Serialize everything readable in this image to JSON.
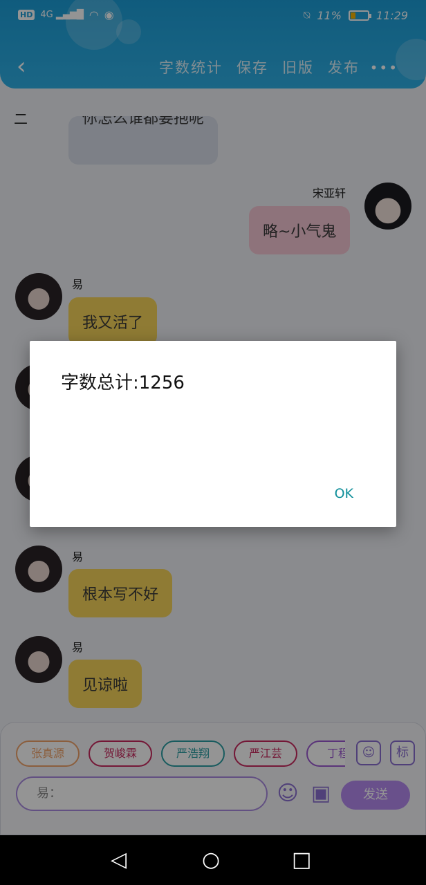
{
  "status_bar": {
    "network": "HD",
    "signal": "4G",
    "battery_text": "11%",
    "battery_level": 0.11,
    "time": "11:29"
  },
  "header": {
    "actions": [
      "字数统计",
      "保存",
      "旧版",
      "发布"
    ],
    "accent_color": "#1c9ed8"
  },
  "chat": {
    "section_mark": "二",
    "messages": [
      {
        "side": "left",
        "sender": "",
        "text": "你怎么谁都要抱呢",
        "color": "grey"
      },
      {
        "side": "right",
        "sender": "宋亚轩",
        "text": "略~小气鬼",
        "color": "pink"
      },
      {
        "side": "left",
        "sender": "易",
        "text": "我又活了",
        "color": "yellow"
      },
      {
        "side": "left",
        "sender": "易",
        "text": "根本写不好",
        "color": "yellow"
      },
      {
        "side": "left",
        "sender": "易",
        "text": "见谅啦",
        "color": "yellow"
      }
    ]
  },
  "composer": {
    "chips": [
      {
        "label": "张真源",
        "color": "#f0a36a"
      },
      {
        "label": "贺峻霖",
        "color": "#c8285e"
      },
      {
        "label": "严浩翔",
        "color": "#2a9ea3"
      },
      {
        "label": "严江芸",
        "color": "#c8285e"
      },
      {
        "label": "丁程",
        "color": "#9b59d0"
      }
    ],
    "tag_button": "标",
    "input_placeholder": "易：",
    "send_label": "发送"
  },
  "dialog": {
    "message": "字数总计:1256",
    "ok_label": "OK"
  }
}
